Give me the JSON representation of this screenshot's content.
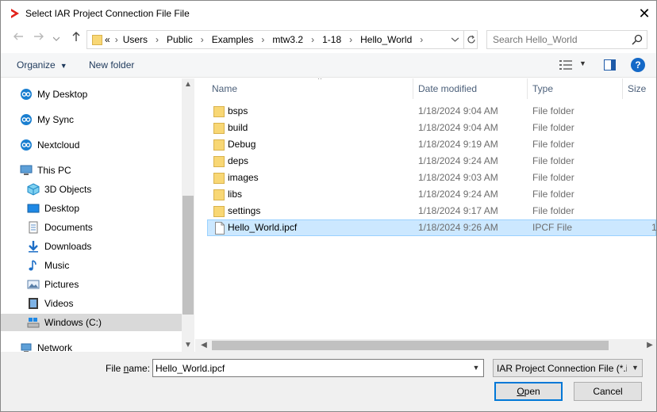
{
  "window": {
    "title": "Select IAR Project Connection File File",
    "close_glyph": "✕"
  },
  "address": {
    "prefix": "«",
    "crumbs": [
      "Users",
      "Public",
      "Examples",
      "mtw3.2",
      "1-18",
      "Hello_World"
    ],
    "search_placeholder": "Search Hello_World"
  },
  "toolbar": {
    "organize": "Organize",
    "new_folder": "New folder"
  },
  "nav": {
    "items": [
      {
        "label": "My Desktop",
        "icon": "sync-cloud-icon"
      },
      {
        "label": "My Sync",
        "icon": "sync-cloud-icon"
      },
      {
        "label": "Nextcloud",
        "icon": "sync-cloud-icon"
      },
      {
        "label": "This PC",
        "icon": "computer-icon"
      },
      {
        "label": "3D Objects",
        "icon": "cube-icon"
      },
      {
        "label": "Desktop",
        "icon": "desktop-icon"
      },
      {
        "label": "Documents",
        "icon": "document-icon"
      },
      {
        "label": "Downloads",
        "icon": "download-icon"
      },
      {
        "label": "Music",
        "icon": "music-icon"
      },
      {
        "label": "Pictures",
        "icon": "picture-icon"
      },
      {
        "label": "Videos",
        "icon": "video-icon"
      },
      {
        "label": "Windows (C:)",
        "icon": "drive-icon"
      },
      {
        "label": "Network",
        "icon": "network-icon"
      }
    ]
  },
  "columns": {
    "name": "Name",
    "date": "Date modified",
    "type": "Type",
    "size": "Size"
  },
  "files": [
    {
      "name": "bsps",
      "date": "1/18/2024 9:04 AM",
      "type": "File folder",
      "kind": "folder"
    },
    {
      "name": "build",
      "date": "1/18/2024 9:04 AM",
      "type": "File folder",
      "kind": "folder"
    },
    {
      "name": "Debug",
      "date": "1/18/2024 9:19 AM",
      "type": "File folder",
      "kind": "folder"
    },
    {
      "name": "deps",
      "date": "1/18/2024 9:24 AM",
      "type": "File folder",
      "kind": "folder"
    },
    {
      "name": "images",
      "date": "1/18/2024 9:03 AM",
      "type": "File folder",
      "kind": "folder"
    },
    {
      "name": "libs",
      "date": "1/18/2024 9:24 AM",
      "type": "File folder",
      "kind": "folder"
    },
    {
      "name": "settings",
      "date": "1/18/2024 9:17 AM",
      "type": "File folder",
      "kind": "folder"
    },
    {
      "name": "Hello_World.ipcf",
      "date": "1/18/2024 9:26 AM",
      "type": "IPCF File",
      "kind": "file",
      "size": "1"
    }
  ],
  "bottom": {
    "file_name_label_pre": "File ",
    "file_name_label_u": "n",
    "file_name_label_post": "ame:",
    "file_name_value": "Hello_World.ipcf",
    "filter_value": "IAR Project Connection File (*.ipcf)",
    "open_u": "O",
    "open_rest": "pen",
    "cancel": "Cancel"
  },
  "colors": {
    "selection": "#cce8ff",
    "accent": "#0078d7",
    "folder": "#f8d775",
    "logo": "#e2231a"
  }
}
